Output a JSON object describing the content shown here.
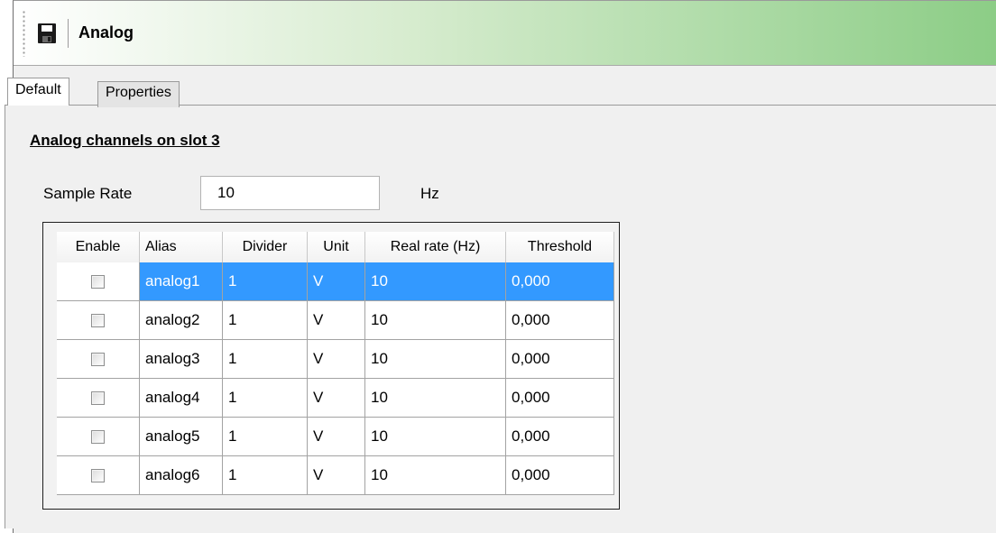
{
  "toolbar": {
    "title": "Analog",
    "save_icon": "floppy-disk-icon"
  },
  "tabs": [
    {
      "label": "Default",
      "active": true
    },
    {
      "label": "Properties",
      "active": false
    }
  ],
  "panel": {
    "heading": "Analog channels on slot 3",
    "sample_rate": {
      "label": "Sample Rate",
      "value": "10",
      "unit": "Hz"
    }
  },
  "table": {
    "columns": [
      "Enable",
      "Alias",
      "Divider",
      "Unit",
      "Real rate (Hz)",
      "Threshold"
    ],
    "selected_row": 0,
    "selection_color": "#3399ff",
    "rows": [
      {
        "enabled": false,
        "alias": "analog1",
        "divider": "1",
        "unit": "V",
        "real_rate": "10",
        "threshold": "0,000"
      },
      {
        "enabled": false,
        "alias": "analog2",
        "divider": "1",
        "unit": "V",
        "real_rate": "10",
        "threshold": "0,000"
      },
      {
        "enabled": false,
        "alias": "analog3",
        "divider": "1",
        "unit": "V",
        "real_rate": "10",
        "threshold": "0,000"
      },
      {
        "enabled": false,
        "alias": "analog4",
        "divider": "1",
        "unit": "V",
        "real_rate": "10",
        "threshold": "0,000"
      },
      {
        "enabled": false,
        "alias": "analog5",
        "divider": "1",
        "unit": "V",
        "real_rate": "10",
        "threshold": "0,000"
      },
      {
        "enabled": false,
        "alias": "analog6",
        "divider": "1",
        "unit": "V",
        "real_rate": "10",
        "threshold": "0,000"
      }
    ]
  }
}
